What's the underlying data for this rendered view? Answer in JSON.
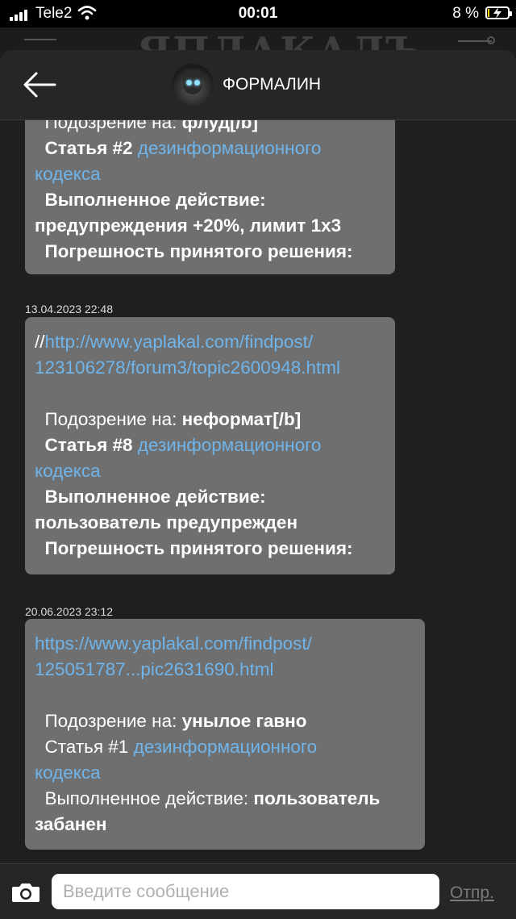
{
  "status_bar": {
    "carrier": "Tele2",
    "time": "00:01",
    "battery_percent": "8 %",
    "icons": [
      "signal-icon",
      "wifi-icon",
      "battery-charging-icon"
    ],
    "battery_level": 0.08,
    "battery_color": "#ffd400"
  },
  "background_header": {
    "logo_text": "ЯПЛАКАЛЪ"
  },
  "chat": {
    "title": "ФОРМАЛИН",
    "back_icon": "back-arrow-icon",
    "avatar_icon": "avatar"
  },
  "messages": [
    {
      "timestamp": "",
      "lines": [
        [
          {
            "t": "  Подозрение на: ",
            "c": ""
          },
          {
            "t": "флуд[/b]",
            "c": "b"
          }
        ],
        [
          {
            "t": "  Статья #2 ",
            "c": "b"
          },
          {
            "t": "дезинформационного",
            "c": "link"
          }
        ],
        [
          {
            "t": "кодекса",
            "c": "link"
          }
        ],
        [
          {
            "t": "  Выполненное действие:",
            "c": "b"
          }
        ],
        [
          {
            "t": "предупреждения +20%, лимит 1x3",
            "c": "b"
          }
        ],
        [
          {
            "t": "  Погрешность принятого решения:",
            "c": "b"
          }
        ]
      ]
    },
    {
      "timestamp": "13.04.2023 22:48",
      "lines": [
        [
          {
            "t": "//",
            "c": ""
          },
          {
            "t": "http://www.yaplakal.com/findpost/",
            "c": "link"
          }
        ],
        [
          {
            "t": "123106278/forum3/topic2600948.html",
            "c": "link"
          }
        ],
        [
          {
            "t": "",
            "c": ""
          }
        ],
        [
          {
            "t": "  Подозрение на: ",
            "c": ""
          },
          {
            "t": "неформат[/b]",
            "c": "b"
          }
        ],
        [
          {
            "t": "  Статья #8 ",
            "c": "b"
          },
          {
            "t": "дезинформационного",
            "c": "link"
          }
        ],
        [
          {
            "t": "кодекса",
            "c": "link"
          }
        ],
        [
          {
            "t": "  Выполненное действие:",
            "c": "b"
          }
        ],
        [
          {
            "t": "пользователь предупрежден",
            "c": "b"
          }
        ],
        [
          {
            "t": "  Погрешность принятого решения:",
            "c": "b"
          }
        ]
      ]
    },
    {
      "timestamp": "20.06.2023 23:12",
      "lines": [
        [
          {
            "t": "https://www.yaplakal.com/findpost/",
            "c": "link"
          }
        ],
        [
          {
            "t": "125051787...pic2631690.html",
            "c": "link"
          }
        ],
        [
          {
            "t": "",
            "c": ""
          }
        ],
        [
          {
            "t": "  Подозрение на: ",
            "c": ""
          },
          {
            "t": "унылое гавно",
            "c": "b"
          }
        ],
        [
          {
            "t": "  Статья #1 ",
            "c": ""
          },
          {
            "t": "дезинформационного",
            "c": "link"
          }
        ],
        [
          {
            "t": "кодекса",
            "c": "link"
          }
        ],
        [
          {
            "t": "  Выполненное действие: ",
            "c": ""
          },
          {
            "t": "пользователь",
            "c": "b"
          }
        ],
        [
          {
            "t": "забанен",
            "c": "b"
          }
        ]
      ]
    }
  ],
  "input_bar": {
    "camera_icon": "camera-icon",
    "placeholder": "Введите сообщение",
    "send_label": "Отпр."
  },
  "colors": {
    "bubble": "#6f6f6f",
    "link": "#6fb4ea",
    "sheet": "#1f1f1f",
    "topbar": "#262626"
  }
}
